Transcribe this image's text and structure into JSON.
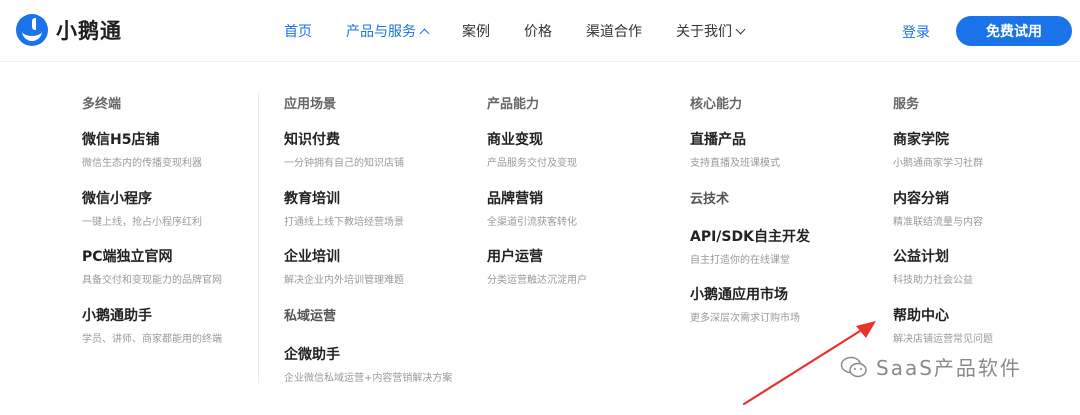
{
  "header": {
    "logo_text": "小鹅通",
    "nav": [
      {
        "label": "首页"
      },
      {
        "label": "产品与服务"
      },
      {
        "label": "案例"
      },
      {
        "label": "价格"
      },
      {
        "label": "渠道合作"
      },
      {
        "label": "关于我们"
      }
    ],
    "login_label": "登录",
    "trial_label": "免费试用"
  },
  "menu": {
    "columns": [
      {
        "heading": "多终端",
        "items": [
          {
            "title": "微信H5店铺",
            "desc": "微信生态内的传播变现利器"
          },
          {
            "title": "微信小程序",
            "desc": "一键上线，抢占小程序红利"
          },
          {
            "title": "PC端独立官网",
            "desc": "具备交付和变现能力的品牌官网"
          },
          {
            "title": "小鹅通助手",
            "desc": "学员、讲师、商家都能用的终端"
          }
        ]
      },
      {
        "heading": "应用场景",
        "items": [
          {
            "title": "知识付费",
            "desc": "一分钟拥有自己的知识店铺"
          },
          {
            "title": "教育培训",
            "desc": "打通线上线下教培经营场景"
          },
          {
            "title": "企业培训",
            "desc": "解决企业内外培训管理难题"
          }
        ],
        "subheading": "私域运营",
        "sub_items": [
          {
            "title": "企微助手",
            "desc": "企业微信私域运营+内容营销解决方案"
          }
        ]
      },
      {
        "heading": "产品能力",
        "items": [
          {
            "title": "商业变现",
            "desc": "产品服务交付及变现"
          },
          {
            "title": "品牌营销",
            "desc": "全渠道引流获客转化"
          },
          {
            "title": "用户运营",
            "desc": "分类运营触达沉淀用户"
          }
        ]
      },
      {
        "heading": "核心能力",
        "items": [
          {
            "title": "直播产品",
            "desc": "支持直播及班课模式"
          }
        ],
        "subheading": "云技术",
        "sub_items": [
          {
            "title": "API/SDK自主开发",
            "desc": "自主打造你的在线课堂"
          },
          {
            "title": "小鹅通应用市场",
            "desc": "更多深层次需求订购市场"
          }
        ]
      },
      {
        "heading": "服务",
        "items": [
          {
            "title": "商家学院",
            "desc": "小鹅通商家学习社群"
          },
          {
            "title": "内容分销",
            "desc": "精准联结流量与内容"
          },
          {
            "title": "公益计划",
            "desc": "科技助力社会公益"
          },
          {
            "title": "帮助中心",
            "desc": "解决店铺运营常见问题"
          }
        ]
      }
    ]
  },
  "watermark": {
    "text": "SaaS产品软件"
  },
  "colors": {
    "accent": "#1a73e8",
    "annotation_arrow": "#e8332b"
  },
  "icons": [
    "logo-mark",
    "chevron-up-icon",
    "chevron-down-icon",
    "wechat-icon"
  ]
}
